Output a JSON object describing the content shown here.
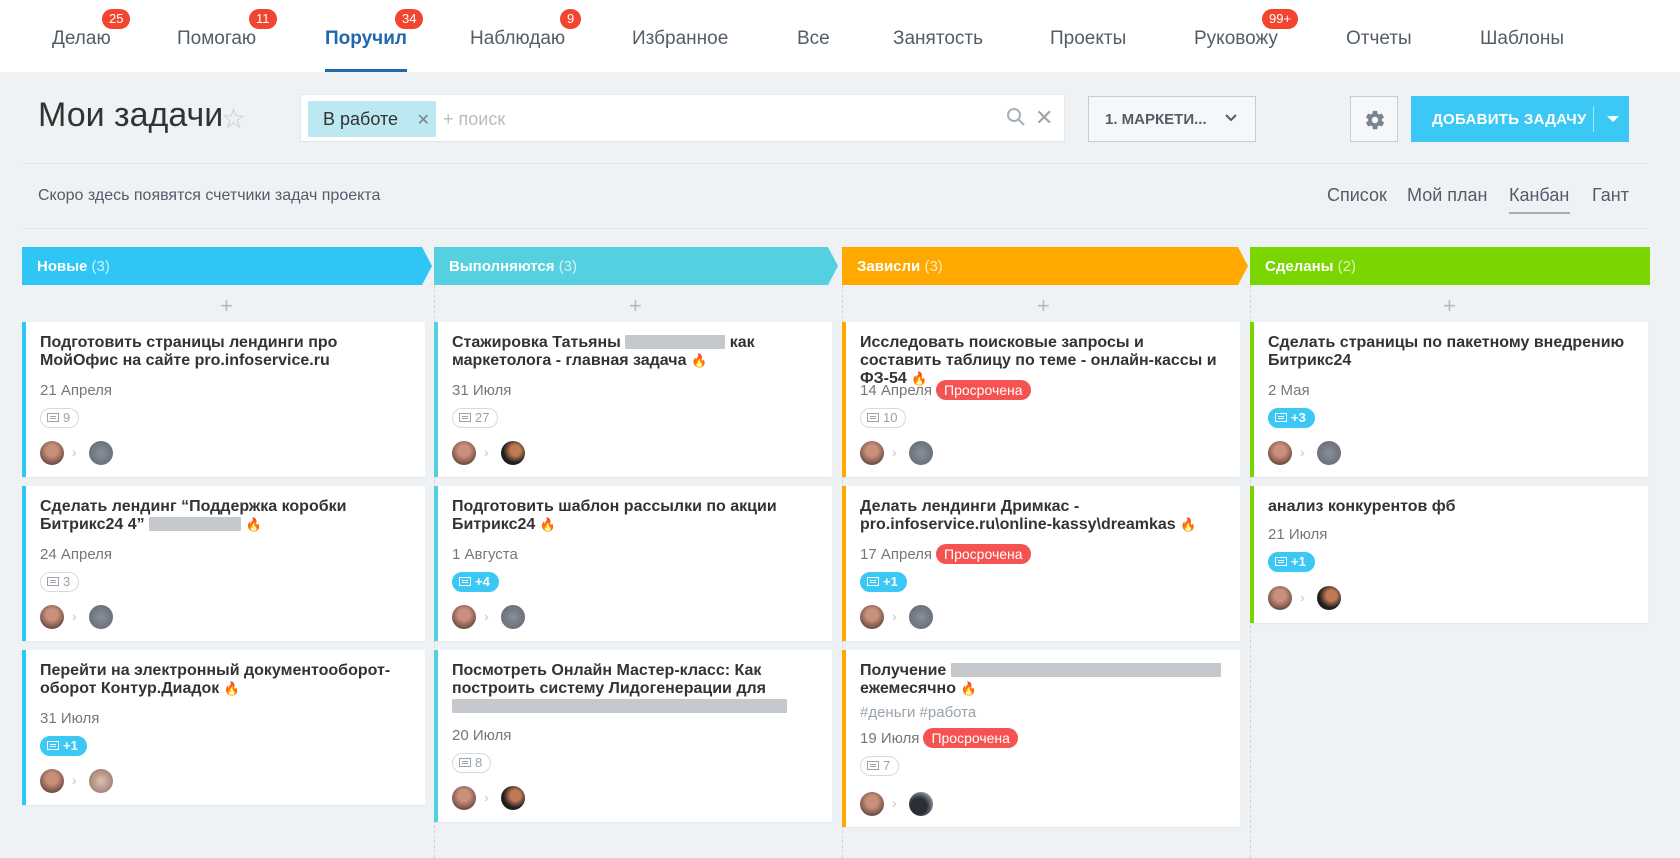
{
  "nav": {
    "tabs": [
      {
        "label": "Делаю",
        "badge": "25"
      },
      {
        "label": "Помогаю",
        "badge": "11"
      },
      {
        "label": "Поручил",
        "badge": "34"
      },
      {
        "label": "Наблюдаю",
        "badge": "9"
      },
      {
        "label": "Избранное",
        "badge": ""
      },
      {
        "label": "Все",
        "badge": ""
      },
      {
        "label": "Занятость",
        "badge": ""
      },
      {
        "label": "Проекты",
        "badge": ""
      },
      {
        "label": "Руковожу",
        "badge": "99+"
      },
      {
        "label": "Отчеты",
        "badge": ""
      },
      {
        "label": "Шаблоны",
        "badge": ""
      }
    ],
    "active_tab": "Поручил"
  },
  "header": {
    "title": "Мои задачи",
    "filter_chip": "В работе",
    "search_placeholder": "+ поиск",
    "project_select": "1. МАРКЕТИ...",
    "add_button": "ДОБАВИТЬ ЗАДАЧУ"
  },
  "hint": "Скоро здесь появятся счетчики задач проекта",
  "views": {
    "items": [
      "Список",
      "Мой план",
      "Канбан",
      "Гант"
    ],
    "active": "Канбан"
  },
  "colors": {
    "new": "#2fc6f6",
    "in_progress": "#55d0e0",
    "stalled": "#ffa900",
    "done": "#7bd500",
    "overdue": "#f55252",
    "accent": "#3bc8f5",
    "badge": "#f2452f"
  },
  "columns": [
    {
      "name": "Новые",
      "count": "(3)",
      "cards": [
        {
          "title": "Подготовить страницы лендинги про МойОфис на сайте pro.infoservice.ru",
          "date": "21 Апреля",
          "comments": "9",
          "comments_new": false
        },
        {
          "title": "Сделать лендинг “Поддержка коробки Битрикс24 4”",
          "date": "24 Апреля",
          "comments": "3",
          "comments_new": false
        },
        {
          "title": "Перейти на электронный документооборот-оборот Контур.Диадок",
          "date": "31 Июля",
          "comments": "+1",
          "comments_new": true
        }
      ]
    },
    {
      "name": "Выполняются",
      "count": "(3)",
      "cards": [
        {
          "title_a": "Стажировка Татьяны",
          "title_b": "как маркетолога - главная задача",
          "date": "31 Июля",
          "comments": "27",
          "comments_new": false
        },
        {
          "title": "Подготовить шаблон рассылки по акции Битрикс24",
          "date": "1 Августа",
          "comments": "+4",
          "comments_new": true
        },
        {
          "title": "Посмотреть Онлайн Мастер-класс: Как построить систему Лидогенерации для",
          "date": "20 Июля",
          "comments": "8",
          "comments_new": false
        }
      ]
    },
    {
      "name": "Зависли",
      "count": "(3)",
      "cards": [
        {
          "title": "Исследовать поисковые запросы и составить таблицу по теме - онлайн-кассы и ФЗ-54",
          "date": "14 Апреля",
          "overdue": "Просрочена",
          "comments": "10",
          "comments_new": false
        },
        {
          "title": "Делать лендинги Дримкас - pro.infoservice.ru\\online-kassy\\dreamkas",
          "date": "17 Апреля",
          "overdue": "Просрочена",
          "comments": "+1",
          "comments_new": true
        },
        {
          "title_a": "Получение",
          "title_b": "ежемесячно",
          "tags": "#деньги #работа",
          "date": "19 Июля",
          "overdue": "Просрочена",
          "comments": "7",
          "comments_new": false
        }
      ]
    },
    {
      "name": "Сделаны",
      "count": "(2)",
      "cards": [
        {
          "title": "Сделать страницы по пакетному внедрению Битрикс24",
          "date": "2 Мая",
          "comments": "+3",
          "comments_new": true
        },
        {
          "title": "анализ конкурентов фб",
          "date": "21 Июля",
          "comments": "+1",
          "comments_new": true
        }
      ]
    }
  ]
}
